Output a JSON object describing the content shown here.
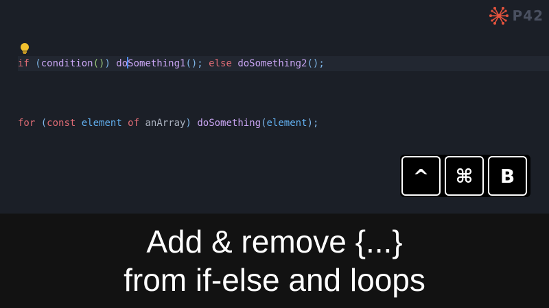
{
  "brand": {
    "name": "P42",
    "accent": "#e5533d"
  },
  "editor": {
    "background": "#1b1f27",
    "line1": {
      "t1": "if",
      "t2": " (",
      "t3": "condition",
      "t4": "()",
      "t5": ") ",
      "t6a": "do",
      "t6b": "Something1",
      "t7": "();",
      "t8": " else ",
      "t9": "doSomething2",
      "t10": "();"
    },
    "line2": {
      "t1": "for",
      "t2": " (",
      "t3": "const",
      "t4": " element",
      "t5": " of",
      "t6": " anArray",
      "t7": ") ",
      "t8": "doSomething",
      "t9": "(",
      "t10": "element",
      "t11": ");"
    }
  },
  "shortcut": {
    "keys": [
      "^",
      "⌘",
      "B"
    ]
  },
  "caption": {
    "line1": "Add & remove {...}",
    "line2": "from if-else and loops"
  }
}
